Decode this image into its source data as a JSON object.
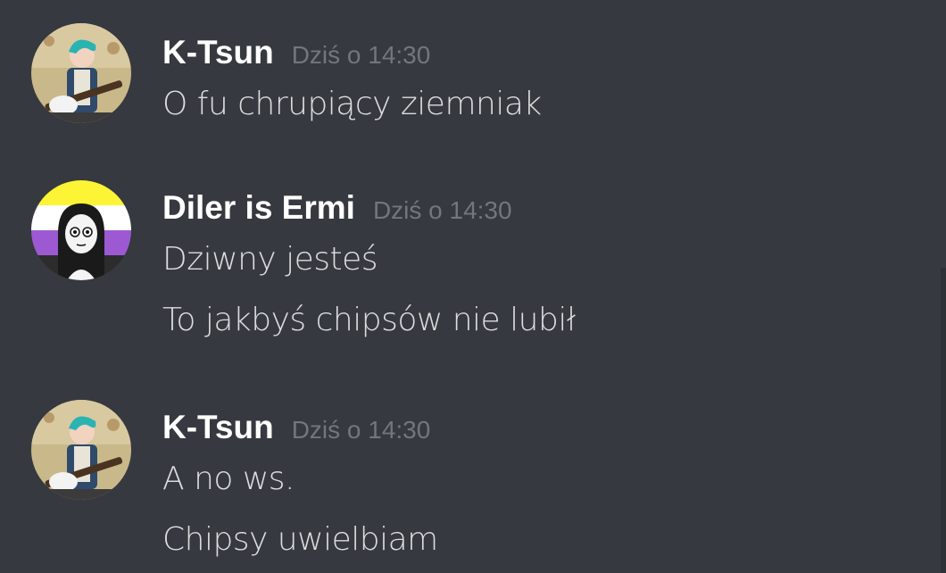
{
  "messages": [
    {
      "username": "K-Tsun",
      "timestamp": "Dziś o 14:30",
      "avatar_icon": "guitar-character-avatar",
      "lines": [
        "O fu chrupiący ziemniak"
      ]
    },
    {
      "username": "Diler is Ermi",
      "timestamp": "Dziś o 14:30",
      "avatar_icon": "nonbinary-flag-character-avatar",
      "lines": [
        "Dziwny jesteś",
        "To jakbyś chipsów nie lubił"
      ]
    },
    {
      "username": "K-Tsun",
      "timestamp": "Dziś o 14:30",
      "avatar_icon": "guitar-character-avatar",
      "lines": [
        "A no ws.",
        "Chipsy uwielbiam"
      ]
    }
  ],
  "colors": {
    "background": "#36393f",
    "username": "#ffffff",
    "timestamp": "#72767d",
    "message_text": "#dcddde",
    "flag_yellow": "#fcf434",
    "flag_white": "#ffffff",
    "flag_purple": "#9c59d1",
    "flag_black": "#2c2c2c"
  }
}
